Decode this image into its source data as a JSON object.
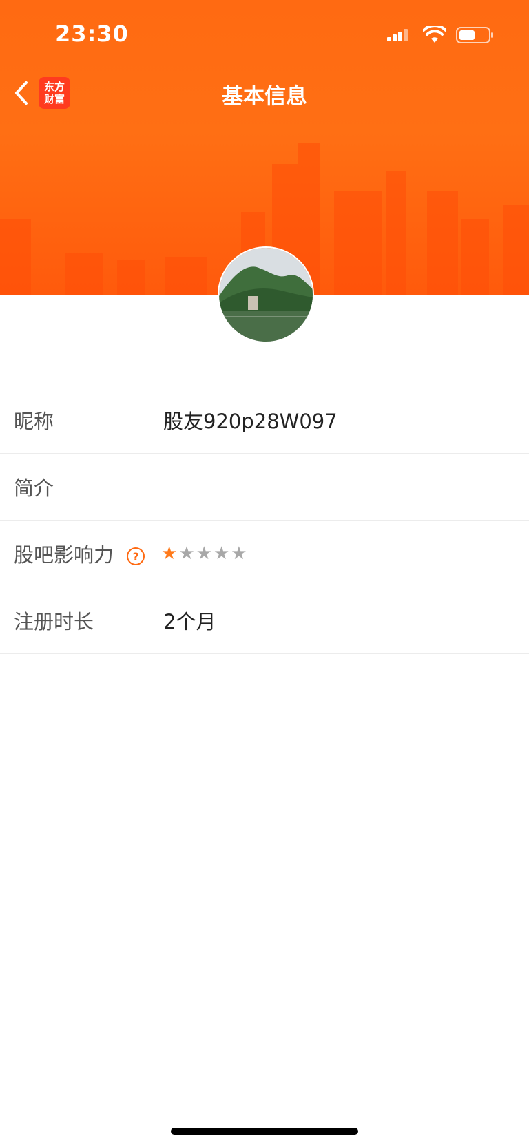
{
  "status": {
    "time": "23:30"
  },
  "nav": {
    "title": "基本信息",
    "logo_line1": "东方",
    "logo_line2": "财富"
  },
  "profile": {
    "rows": [
      {
        "label": "昵称",
        "value": "股友920p28W097"
      },
      {
        "label": "简介",
        "value": ""
      },
      {
        "label": "股吧影响力",
        "help": "?",
        "rating": 1,
        "max": 5
      },
      {
        "label": "注册时长",
        "value": "2个月"
      }
    ]
  },
  "colors": {
    "accent": "#ff6a12",
    "star_on": "#ff7a1a",
    "star_off": "#a8a8a8"
  },
  "icons": {
    "back": "chevron-left-icon",
    "help": "question-circle-icon",
    "star": "star-icon"
  }
}
